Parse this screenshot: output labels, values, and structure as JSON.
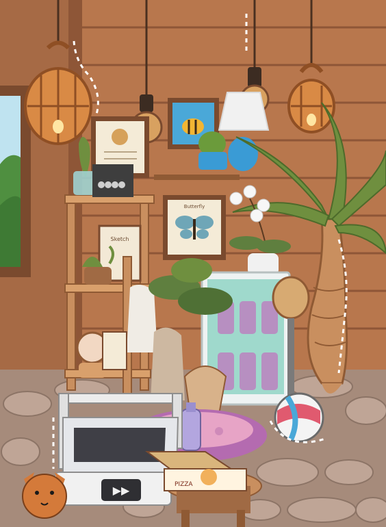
{
  "scene": {
    "name": "cozy-room-scene"
  },
  "labels": {
    "pizza_box_text": "PIZZA",
    "poster_caption": "Butterfly",
    "note_text": "Sketch",
    "treadmill_button": "▶▶"
  },
  "colors": {
    "wall": "#b8774d",
    "wall_dark": "#9d6240",
    "wall_line": "#8e5637",
    "floor": "#a68b7b",
    "stone": "#bfa596",
    "wood": "#c98f5f",
    "wood_dark": "#8f5a34",
    "plant": "#5f7f3f",
    "plant_dark": "#3f5e2b",
    "fridge": "#eef2f2",
    "glass": "#78c4b8",
    "rug": "#b46bb0",
    "treadmill": "#e5e7eb",
    "cat": "#d47a3a"
  },
  "icons": [
    "pendant-lamp-icon",
    "lantern-icon",
    "picture-frame-icon",
    "cactus-icon",
    "potted-plant-icon",
    "palm-tree-icon",
    "orchid-icon",
    "fridge-icon",
    "beach-ball-icon",
    "treadmill-icon",
    "cat-icon",
    "pizza-icon",
    "bottle-icon",
    "rug-icon",
    "towel-icon",
    "shelf-icon"
  ]
}
